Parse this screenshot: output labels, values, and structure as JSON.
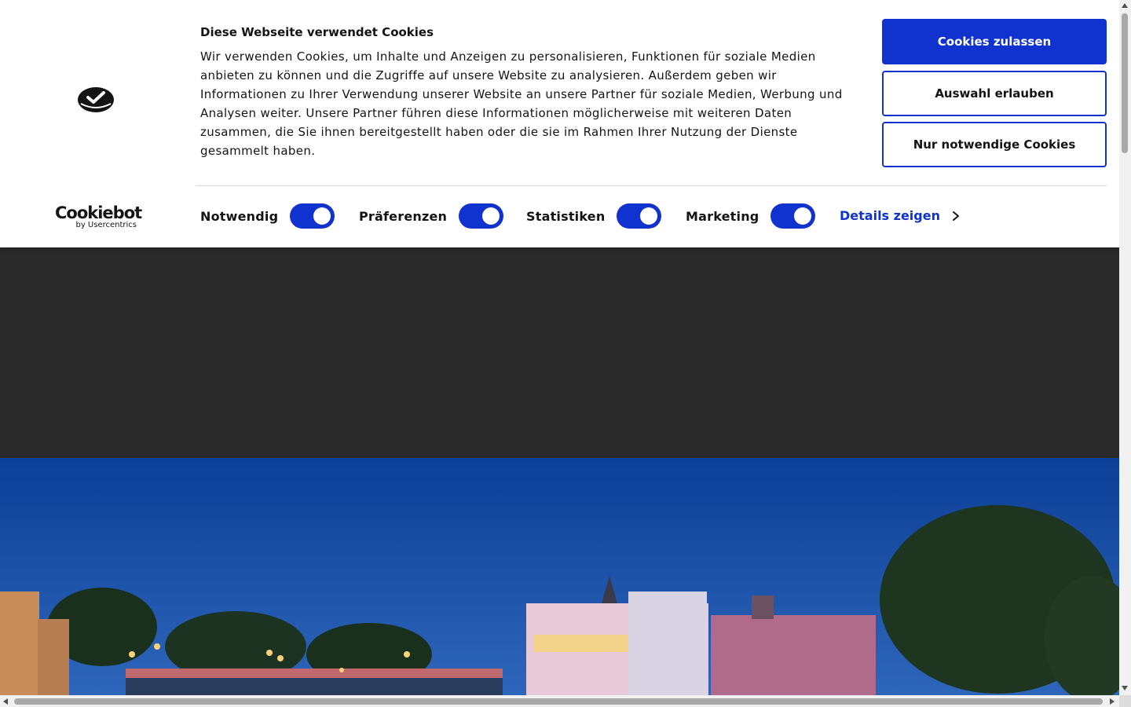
{
  "cookie_banner": {
    "title": "Diese Webseite verwendet Cookies",
    "text": "Wir verwenden Cookies, um Inhalte und Anzeigen zu personalisieren, Funktionen für soziale Medien anbieten zu können und die Zugriffe auf unsere Website zu analysieren. Außerdem geben wir Informationen zu Ihrer Verwendung unserer Website an unsere Partner für soziale Medien, Werbung und Analysen weiter. Unsere Partner führen diese Informationen möglicherweise mit weiteren Daten zusammen, die Sie ihnen bereitgestellt haben oder die sie im Rahmen Ihrer Nutzung der Dienste gesammelt haben.",
    "brand": {
      "name": "Cookiebot",
      "sub": "by Usercentrics"
    },
    "buttons": {
      "allow_all": "Cookies zulassen",
      "allow_selection": "Auswahl erlauben",
      "necessary_only": "Nur notwendige Cookies"
    },
    "categories": [
      {
        "label": "Notwendig",
        "checked": true
      },
      {
        "label": "Präferenzen",
        "checked": true
      },
      {
        "label": "Statistiken",
        "checked": true
      },
      {
        "label": "Marketing",
        "checked": true
      }
    ],
    "details_link": "Details zeigen",
    "accent_color": "#1032cf"
  },
  "hero": {
    "image": "town-riverside-bridge-night",
    "sky_color": "#1a4fa8"
  },
  "icons": {
    "logo": "cookiebot-logo-icon",
    "chevron": "chevron-right-icon"
  }
}
